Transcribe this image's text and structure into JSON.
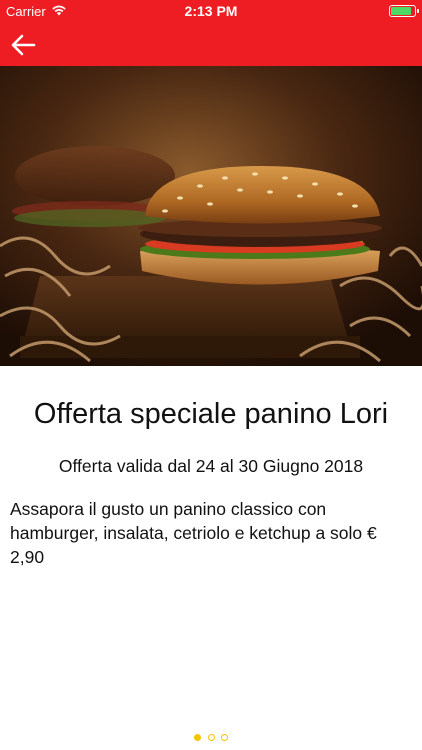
{
  "status_bar": {
    "carrier": "Carrier",
    "time": "2:13 PM",
    "battery_level": 0.9
  },
  "nav": {
    "back_icon": "arrow-left-icon",
    "color": "#ee1c23"
  },
  "hero": {
    "image": "burger-photo"
  },
  "offer": {
    "title": "Offerta speciale panino Lori",
    "validity": "Offerta valida dal 24 al 30 Giugno 2018",
    "description": "Assapora il gusto un panino classico con hamburger, insalata, cetriolo e ketchup a solo € 2,90"
  },
  "pager": {
    "count": 3,
    "active_index": 0,
    "color": "#f5c400"
  }
}
